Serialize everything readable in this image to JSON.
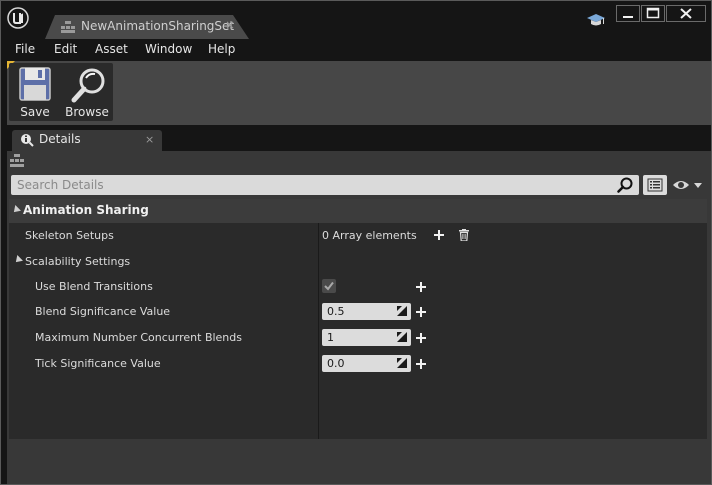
{
  "window": {
    "tab_title": "NewAnimationSharingSet",
    "tab_close": "×"
  },
  "menu": [
    "File",
    "Edit",
    "Asset",
    "Window",
    "Help"
  ],
  "toolbar": {
    "save_label": "Save",
    "browse_label": "Browse",
    "accent_color": "#e3b434"
  },
  "details_panel": {
    "tab_label": "Details",
    "tab_close": "×",
    "search_placeholder": "Search Details",
    "category": "Animation Sharing",
    "skeleton_setups": {
      "label": "Skeleton Setups",
      "value": "0 Array elements"
    },
    "scalability": {
      "label": "Scalability Settings",
      "use_blend_transitions": {
        "label": "Use Blend Transitions",
        "checked": true
      },
      "blend_significance": {
        "label": "Blend Significance Value",
        "value": "0.5"
      },
      "max_concurrent_blends": {
        "label": "Maximum Number Concurrent Blends",
        "value": "1"
      },
      "tick_significance": {
        "label": "Tick Significance Value",
        "value": "0.0"
      }
    }
  }
}
